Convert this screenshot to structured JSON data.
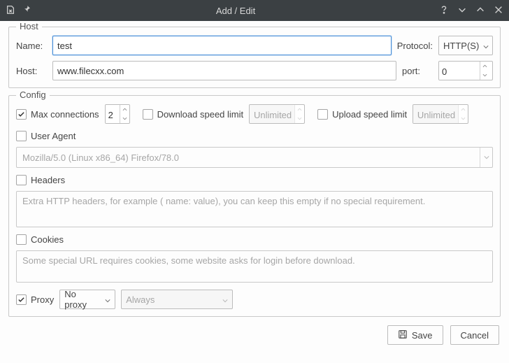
{
  "titlebar": {
    "title": "Add / Edit"
  },
  "host": {
    "legend": "Host",
    "name_label": "Name:",
    "name_value": "test",
    "protocol_label": "Protocol:",
    "protocol_value": "HTTP(S)",
    "host_label": "Host:",
    "host_value": "www.filecxx.com",
    "port_label": "port:",
    "port_value": "0"
  },
  "config": {
    "legend": "Config",
    "max_conn_label": "Max connections",
    "max_conn_value": "2",
    "dl_limit_label": "Download speed limit",
    "dl_limit_value": "Unlimited",
    "ul_limit_label": "Upload speed limit",
    "ul_limit_value": "Unlimited",
    "user_agent_label": "User Agent",
    "user_agent_value": "Mozilla/5.0 (Linux x86_64) Firefox/78.0",
    "headers_label": "Headers",
    "headers_placeholder": "Extra HTTP headers, for example ( name: value), you can keep this empty if no special requirement.",
    "cookies_label": "Cookies",
    "cookies_placeholder": "Some special URL requires cookies, some website asks for login before download.",
    "proxy_label": "Proxy",
    "proxy_value": "No proxy",
    "proxy_when": "Always"
  },
  "buttons": {
    "save": "Save",
    "cancel": "Cancel"
  }
}
